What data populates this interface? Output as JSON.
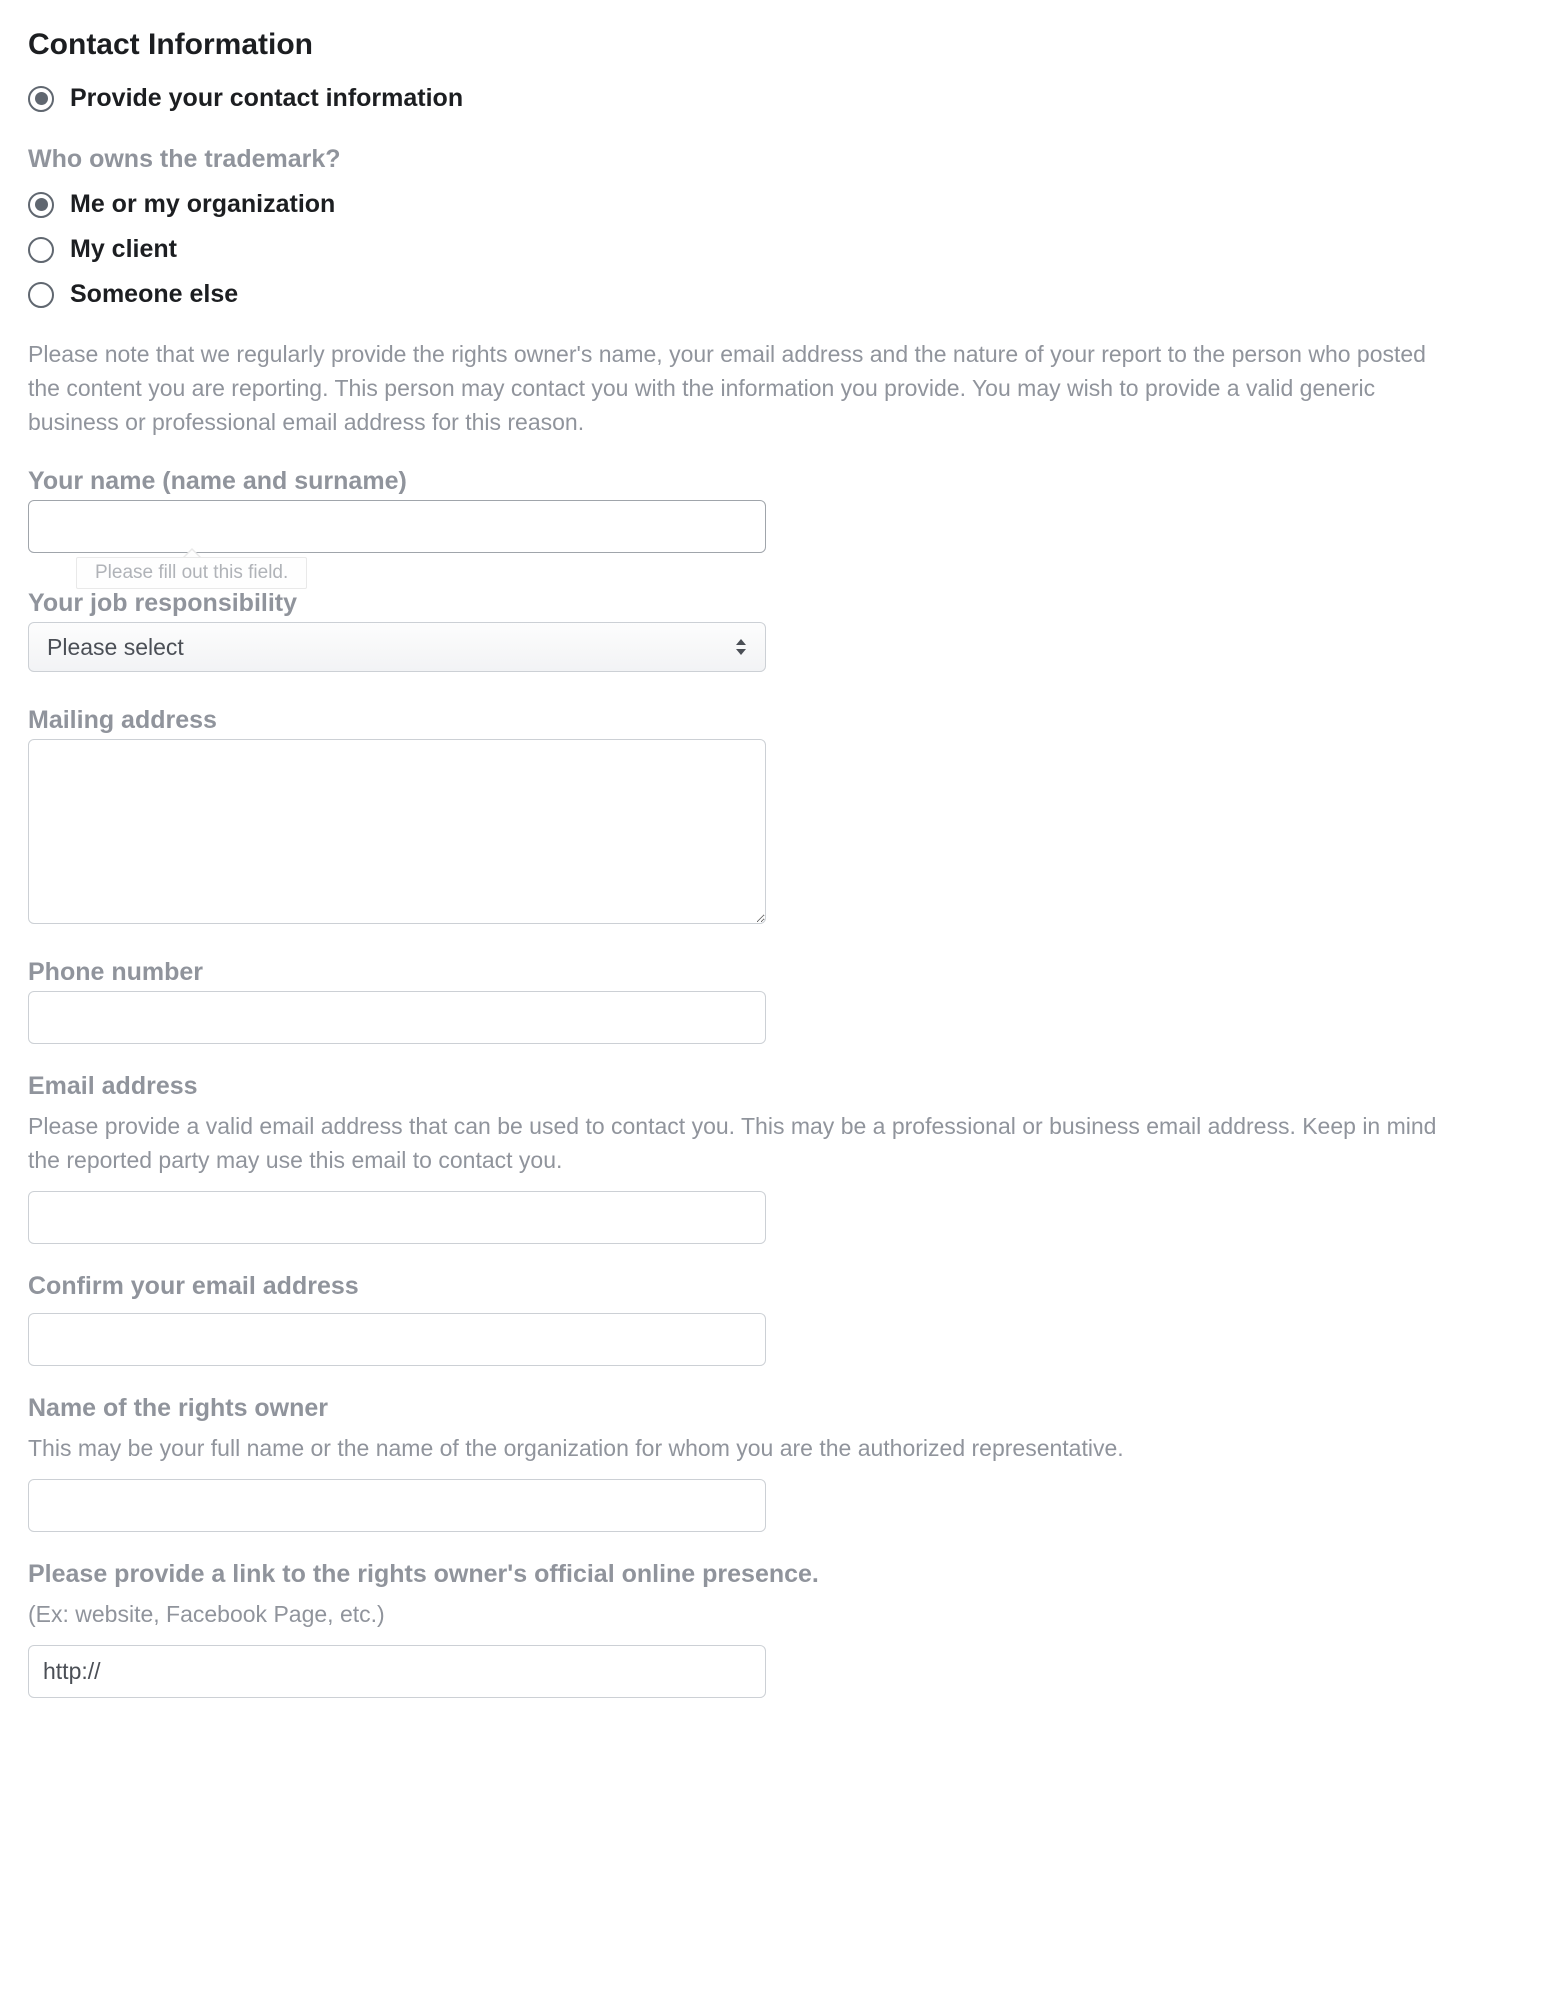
{
  "section_title": "Contact Information",
  "provide_contact": {
    "label": "Provide your contact information",
    "checked": true
  },
  "owner_question": "Who owns the trademark?",
  "owner_options": [
    {
      "label": "Me or my organization",
      "checked": true
    },
    {
      "label": "My client",
      "checked": false
    },
    {
      "label": "Someone else",
      "checked": false
    }
  ],
  "disclosure_note": "Please note that we regularly provide the rights owner's name, your email address and the nature of your report to the person who posted the content you are reporting. This person may contact you with the information you provide. You may wish to provide a valid generic business or professional email address for this reason.",
  "name_field": {
    "label": "Your name (name and surname)",
    "value": "",
    "validation_msg": "Please fill out this field."
  },
  "job_field": {
    "label": "Your job responsibility",
    "placeholder": "Please select"
  },
  "mailing_field": {
    "label": "Mailing address",
    "value": ""
  },
  "phone_field": {
    "label": "Phone number",
    "value": ""
  },
  "email_field": {
    "label": "Email address",
    "helper": "Please provide a valid email address that can be used to contact you. This may be a professional or business email address. Keep in mind the reported party may use this email to contact you.",
    "value": ""
  },
  "confirm_email_field": {
    "label": "Confirm your email address",
    "value": ""
  },
  "rights_owner_field": {
    "label": "Name of the rights owner",
    "helper": "This may be your full name or the name of the organization for whom you are the authorized representative.",
    "value": ""
  },
  "link_field": {
    "label": "Please provide a link to the rights owner's official online presence.",
    "helper": "(Ex: website, Facebook Page, etc.)",
    "value": "http://"
  }
}
